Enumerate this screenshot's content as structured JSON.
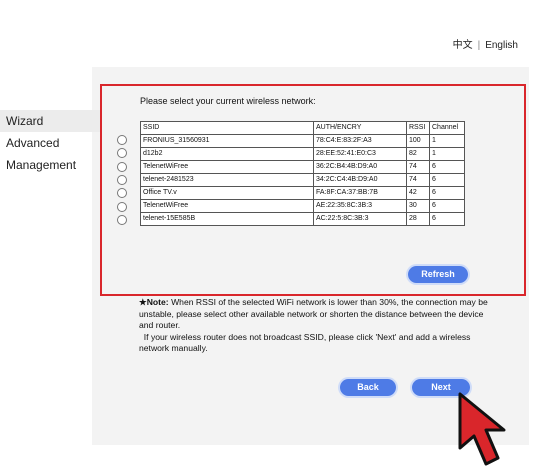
{
  "lang": {
    "chinese": "中文",
    "separator": "|",
    "english": "English"
  },
  "sidebar": {
    "items": [
      {
        "label": "Wizard"
      },
      {
        "label": "Advanced"
      },
      {
        "label": "Management"
      }
    ]
  },
  "wizard": {
    "prompt": "Please select your current wireless network:",
    "columns": [
      "SSID",
      "AUTH/ENCRY",
      "RSSI",
      "Channel"
    ],
    "rows": [
      {
        "ssid": "FRONIUS_31560931",
        "auth": "78:C4:E:83:2F:A3",
        "rssi": "100",
        "channel": "1"
      },
      {
        "ssid": "d12b2",
        "auth": "28:EE:52:41:E0:C3",
        "rssi": "82",
        "channel": "1"
      },
      {
        "ssid": "TelenetWiFree",
        "auth": "36:2C:B4:4B:D9:A0",
        "rssi": "74",
        "channel": "6"
      },
      {
        "ssid": "telenet-2481523",
        "auth": "34:2C:C4:4B:D9:A0",
        "rssi": "74",
        "channel": "6"
      },
      {
        "ssid": "Office TV.v",
        "auth": "FA:8F:CA:37:BB:7B",
        "rssi": "42",
        "channel": "6"
      },
      {
        "ssid": "TelenetWiFree",
        "auth": "AE:22:35:8C:3B:3",
        "rssi": "30",
        "channel": "6"
      },
      {
        "ssid": "telenet-15E585B",
        "auth": "AC:22:5:8C:3B:3",
        "rssi": "28",
        "channel": "6"
      }
    ],
    "refresh_label": "Refresh"
  },
  "note": {
    "title": "★Note:",
    "line1": "When RSSI of the selected WiFi network is lower than 30%,  the connection may be unstable,  please select other available network or shorten the distance between the device and router.",
    "line2": "If your wireless router does not broadcast SSID,  please click  'Next'  and add a wireless network manually."
  },
  "buttons": {
    "back": "Back",
    "next": "Next"
  },
  "colors": {
    "accent": "#4e7be6",
    "highlight_border": "#d9262b",
    "cursor": "#d9262b"
  }
}
